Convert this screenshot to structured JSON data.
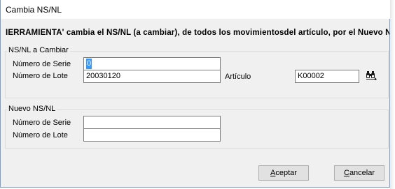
{
  "window": {
    "title": "Cambia NS/NL"
  },
  "banner": {
    "text": "IERRAMIENTA' cambia el NS/NL (a cambiar), de todos los movimientosdel artículo, por el Nuevo NS/NL inc"
  },
  "group_cambiar": {
    "label": "NS/NL a Cambiar",
    "serie_label": "Número de Serie",
    "serie_value": "0",
    "lote_label": "Número de Lote",
    "lote_value": "20030120",
    "articulo_label": "Artículo",
    "articulo_value": "K00002",
    "search_icon": "binoculars-icon"
  },
  "group_nuevo": {
    "label": "Nuevo NS/NL",
    "serie_label": "Número de Serie",
    "serie_value": "",
    "lote_label": "Número de Lote",
    "lote_value": ""
  },
  "buttons": {
    "aceptar_first": "A",
    "aceptar_rest": "ceptar",
    "cancelar_first": "C",
    "cancelar_rest": "ancelar"
  }
}
